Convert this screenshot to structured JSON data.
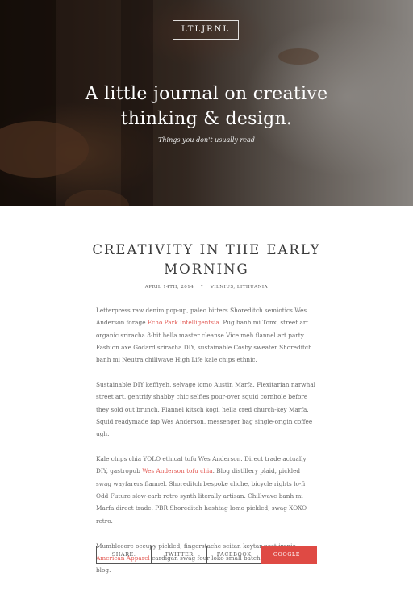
{
  "header": {
    "logo": "LTLJRNL",
    "headline_line1": "A little journal on creative",
    "headline_line2": "thinking & design.",
    "tagline": "Things you don't usually read"
  },
  "article": {
    "title_line1": "CREATIVITY IN THE EARLY",
    "title_line2": "MORNING",
    "date": "APRIL 14TH, 2014",
    "location": "VILNIUS, LITHUANIA",
    "paragraphs": [
      {
        "before": "Letterpress raw denim pop-up, paleo bitters Shoreditch semiotics Wes Anderson forage ",
        "link": "Echo Park Intelligentsia",
        "after": ". Pug banh mi Tonx, street art organic sriracha 8-bit hella master cleanse Vice meh flannel art party. Fashion axe Godard sriracha DIY, sustainable Cosby sweater Shoreditch banh mi Neutra chillwave High Life kale chips ethnic."
      },
      {
        "text": "Sustainable DIY keffiyeh, selvage lomo Austin Marfa. Flexitarian narwhal street art, gentrify shabby chic selfies pour-over squid cornhole before they sold out brunch. Flannel kitsch kogi, hella cred church-key Marfa. Squid readymade fap Wes Anderson, messenger bag single-origin coffee ugh."
      },
      {
        "before": "Kale chips chia YOLO ethical tofu Wes Anderson. Direct trade actually DIY, gastropub ",
        "link": "Wes Anderson tofu chia",
        "after": ". Blog distillery plaid, pickled swag wayfarers flannel. Shoreditch bespoke cliche, bicycle rights lo-fi Odd Future slow-carb retro synth literally artisan. Chillwave banh mi Marfa direct trade. PBR Shoreditch hashtag lomo pickled, swag XOXO retro."
      },
      {
        "before": "Mumblecore occupy pickled, fingerstache seitan keytar post-ironic ",
        "link": "American Apparel",
        "after": " cardigan swag four loko small batch irony biodiesel blog."
      }
    ]
  },
  "share": {
    "label": "SHARE:",
    "twitter": "TWITTER",
    "facebook": "FACEBOOK",
    "google": "GOOGLE+"
  },
  "colors": {
    "accent": "#df4a44",
    "link": "#e25a54"
  }
}
